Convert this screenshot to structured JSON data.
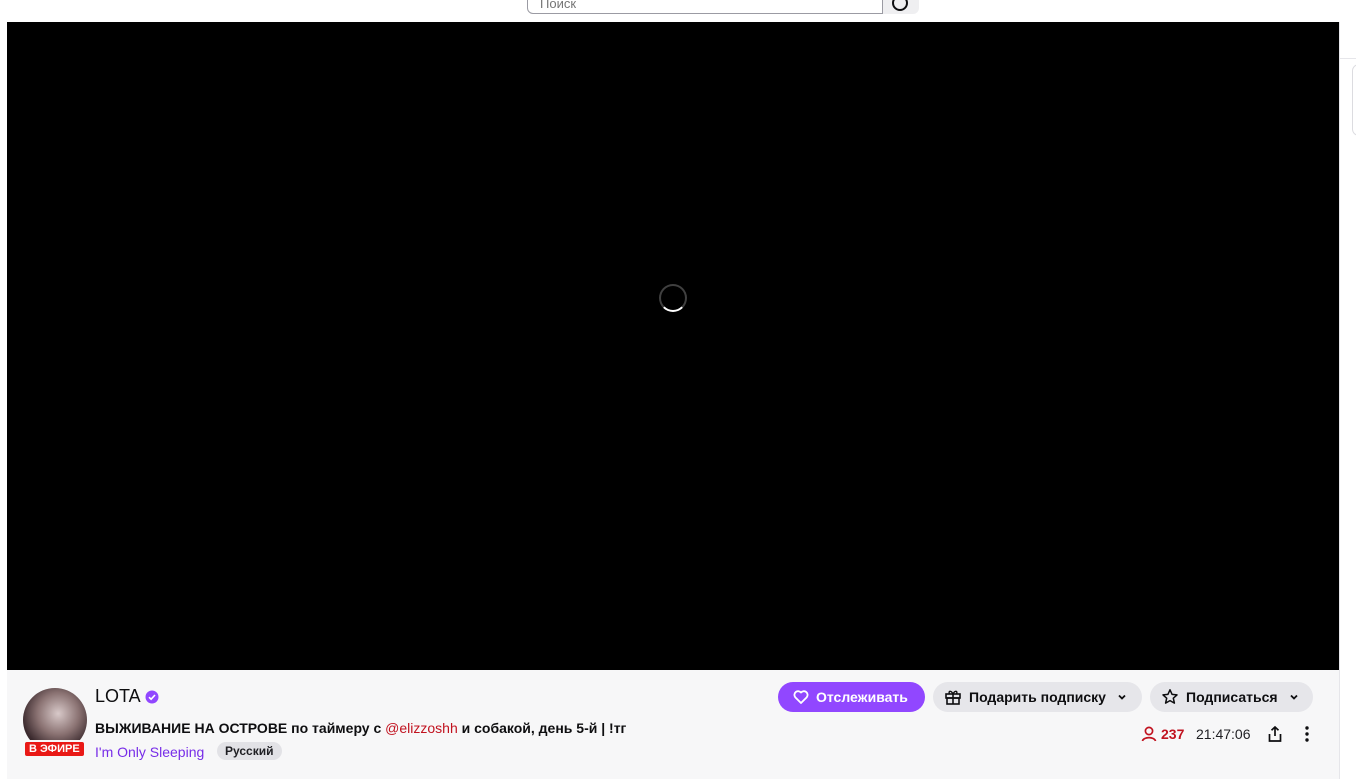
{
  "search": {
    "placeholder": "Поиск"
  },
  "channel": {
    "name": "LOTA",
    "live_badge": "В ЭФИРЕ",
    "title_main": "ВЫЖИВАНИЕ НА ОСТРОВЕ по таймеру с ",
    "title_mention": "@elizzoshh",
    "title_rest": " и собакой, день 5-й | !тг",
    "category": "I'm Only Sleeping",
    "tag": "Русский"
  },
  "actions": {
    "follow": "Отслеживать",
    "gift": "Подарить подписку",
    "subscribe": "Подписаться"
  },
  "stats": {
    "viewers": "237",
    "uptime": "21:47:06"
  },
  "colors": {
    "accent": "#9147ff",
    "live": "#e91916",
    "viewers": "#c1121f"
  }
}
